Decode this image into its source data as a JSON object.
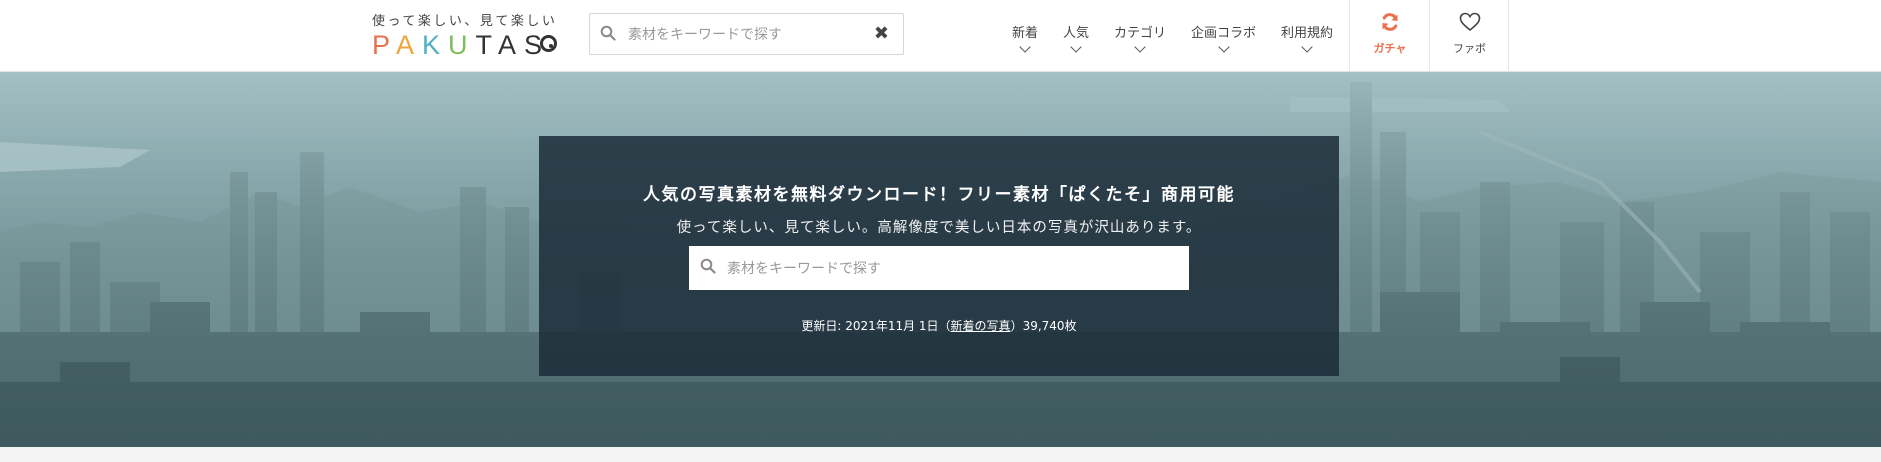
{
  "header": {
    "tagline": "使って楽しい、見て楽しい",
    "logo": {
      "p1": "P",
      "p2": "A",
      "p3": "K",
      "p4": "U",
      "rest": "TAS"
    },
    "search": {
      "placeholder": "素材をキーワードで探す",
      "value": ""
    },
    "nav": [
      {
        "label": "新着"
      },
      {
        "label": "人気"
      },
      {
        "label": "カテゴリ"
      },
      {
        "label": "企画コラボ"
      },
      {
        "label": "利用規約"
      }
    ],
    "gacha_label": "ガチャ",
    "fav_label": "ファボ"
  },
  "hero": {
    "title": "人気の写真素材を無料ダウンロード！フリー素材「ぱくたそ」商用可能",
    "subtitle": "使って楽しい、見て楽しい。高解像度で美しい日本の写真が沢山あります。",
    "search": {
      "placeholder": "素材をキーワードで探す",
      "value": ""
    },
    "updated_prefix": "更新日: 2021年11月 1日（",
    "new_photos_link": "新着の写真",
    "updated_suffix": "）39,740枚"
  },
  "colors": {
    "accent": "#e8704f",
    "hero_box": "#1c2c38",
    "header_bg": "#ffffff"
  },
  "icons": [
    "search-icon",
    "close-icon",
    "refresh-icon",
    "heart-icon",
    "chevron-down-icon"
  ]
}
